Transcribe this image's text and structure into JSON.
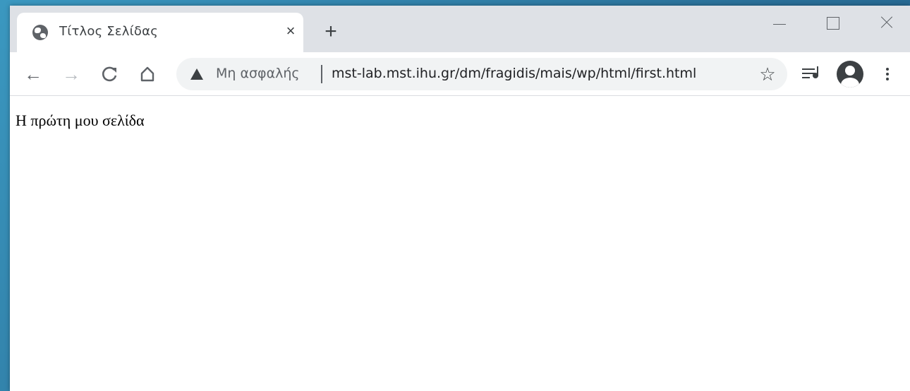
{
  "tab": {
    "title": "Τίτλος Σελίδας",
    "close_glyph": "×",
    "favicon": "globe-icon"
  },
  "new_tab_glyph": "+",
  "toolbar": {
    "back_glyph": "←",
    "forward_glyph": "→",
    "reload_glyph": "C",
    "home_glyph": "⌂",
    "security_label": "Μη ασφαλής",
    "url": "mst-lab.mst.ihu.gr/dm/fragidis/mais/wp/html/first.html",
    "star_glyph": "☆"
  },
  "page": {
    "text": "Η πρώτη μου σελίδα"
  },
  "colors": {
    "tabstrip": "#dee1e6",
    "omnibox": "#f1f3f4",
    "desktop": "#2f7fa8"
  }
}
